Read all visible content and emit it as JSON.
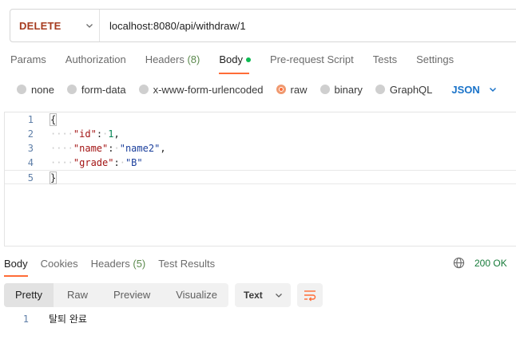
{
  "request": {
    "method": "DELETE",
    "url": "localhost:8080/api/withdraw/1"
  },
  "request_tabs": [
    {
      "label": "Params"
    },
    {
      "label": "Authorization"
    },
    {
      "label": "Headers",
      "count": "(8)"
    },
    {
      "label": "Body",
      "active": true,
      "indicator": "green-dot"
    },
    {
      "label": "Pre-request Script"
    },
    {
      "label": "Tests"
    },
    {
      "label": "Settings"
    }
  ],
  "body_types": {
    "options": [
      "none",
      "form-data",
      "x-www-form-urlencoded",
      "raw",
      "binary",
      "GraphQL"
    ],
    "selected": "raw",
    "format": "JSON"
  },
  "editor": {
    "line_numbers": [
      "1",
      "2",
      "3",
      "4",
      "5"
    ],
    "open_brace": "{",
    "close_brace": "}",
    "fields": [
      {
        "key": "\"id\"",
        "value": "1",
        "type": "number",
        "comma": ","
      },
      {
        "key": "\"name\"",
        "value": "\"name2\"",
        "type": "string",
        "comma": ","
      },
      {
        "key": "\"grade\"",
        "value": "\"B\"",
        "type": "string",
        "comma": ""
      }
    ]
  },
  "response_tabs": [
    {
      "label": "Body",
      "active": true
    },
    {
      "label": "Cookies"
    },
    {
      "label": "Headers",
      "count": "(5)"
    },
    {
      "label": "Test Results"
    }
  ],
  "response": {
    "status": "200 OK",
    "views": [
      "Pretty",
      "Raw",
      "Preview",
      "Visualize"
    ],
    "active_view": "Pretty",
    "format": "Text",
    "line_number": "1",
    "body": "탈퇴 완료"
  },
  "icons": {
    "method_dropdown": "chevron-down-icon",
    "format_dropdown": "chevron-down-icon",
    "status_globe": "globe-icon",
    "wrap": "wrap-lines-icon"
  },
  "colors": {
    "accent": "#ff6c37",
    "method": "#a63b1f",
    "status_ok": "#177b3a",
    "json_select": "#1a73c9",
    "body_dot": "#0cbb52"
  }
}
